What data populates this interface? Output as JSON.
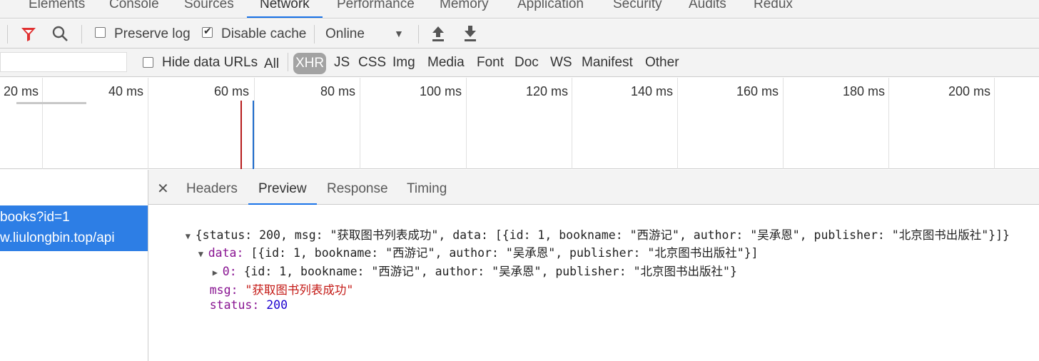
{
  "tabs": [
    "Elements",
    "Console",
    "Sources",
    "Network",
    "Performance",
    "Memory",
    "Application",
    "Security",
    "Audits",
    "Redux"
  ],
  "toolbar": {
    "preserve_log": "Preserve log",
    "disable_cache": "Disable cache",
    "throttle": "Online"
  },
  "filter": {
    "hide_data_urls": "Hide data URLs",
    "types": [
      "All",
      "XHR",
      "JS",
      "CSS",
      "Img",
      "Media",
      "Font",
      "Doc",
      "WS",
      "Manifest",
      "Other"
    ],
    "active_type": "XHR"
  },
  "timeline": {
    "ticks": [
      "20 ms",
      "40 ms",
      "60 ms",
      "80 ms",
      "100 ms",
      "120 ms",
      "140 ms",
      "160 ms",
      "180 ms",
      "200 ms"
    ]
  },
  "request": {
    "name": "books?id=1",
    "host": "w.liulongbin.top/api"
  },
  "detail_tabs": [
    "Headers",
    "Preview",
    "Response",
    "Timing"
  ],
  "active_detail_tab": "Preview",
  "preview": {
    "root": "{status: 200, msg: \"获取图书列表成功\", data: [{id: 1, bookname: \"西游记\", author: \"吴承恩\", publisher: \"北京图书出版社\"}]}",
    "data_key": "data",
    "data_summary": "[{id: 1, bookname: \"西游记\", author: \"吴承恩\", publisher: \"北京图书出版社\"}]",
    "item_key": "0",
    "item_summary": "{id: 1, bookname: \"西游记\", author: \"吴承恩\", publisher: \"北京图书出版社\"}",
    "msg_key": "msg",
    "msg_value": "\"获取图书列表成功\"",
    "status_key": "status",
    "status_value": "200"
  },
  "colors": {
    "active_tab_underline": "#1a73e8",
    "selected_row": "#2d7ee5",
    "filter_icon": "#e03030",
    "dom_content_loaded_line": "#1e6bcc",
    "load_line": "#b71c1c"
  }
}
